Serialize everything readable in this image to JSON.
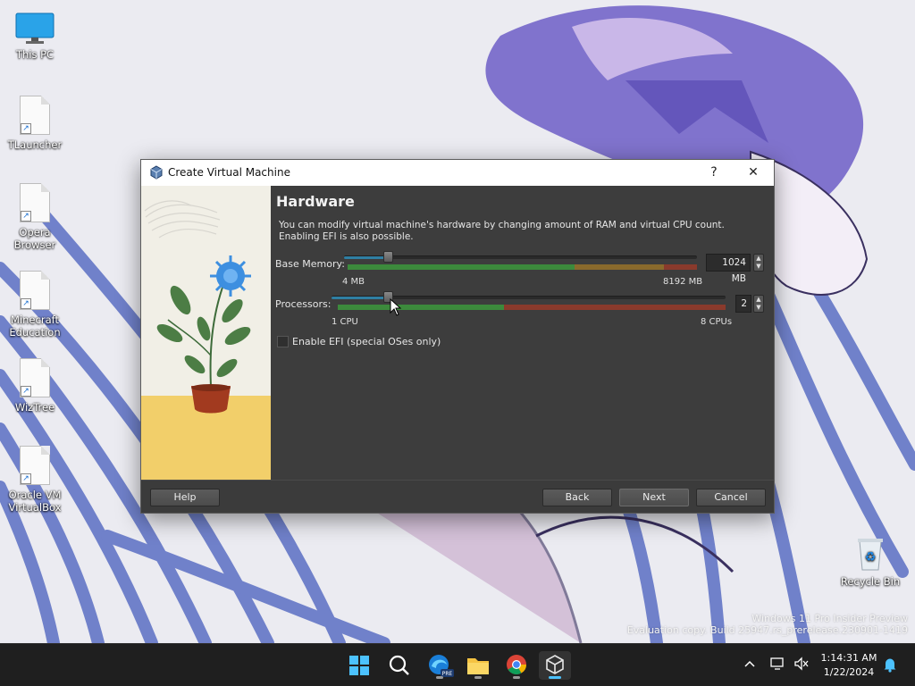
{
  "desktop": {
    "icons": [
      {
        "label": "This PC"
      },
      {
        "label": "TLauncher"
      },
      {
        "label": "Opera Browser"
      },
      {
        "label": "Minecraft Education"
      },
      {
        "label": "WizTree"
      },
      {
        "label": "Oracle VM VirtualBox"
      }
    ],
    "recycle_bin": "Recycle Bin",
    "watermark_line1": "Windows 11 Pro Insider Preview",
    "watermark_line2": "Evaluation copy. Build 25947.rs_prerelease.230901-1419"
  },
  "dialog": {
    "title": "Create Virtual Machine",
    "help_glyph": "?",
    "close_glyph": "✕",
    "heading": "Hardware",
    "description": "You can modify virtual machine's hardware by changing amount of RAM and virtual CPU count. Enabling EFI is also possible.",
    "memory": {
      "label": "Base Memory:",
      "value": "1024 MB",
      "min_label": "4 MB",
      "max_label": "8192 MB",
      "value_mb": 1024,
      "min_mb": 4,
      "max_mb": 8192
    },
    "processors": {
      "label": "Processors:",
      "value": "2",
      "min_label": "1 CPU",
      "max_label": "8 CPUs",
      "value_count": 2,
      "min_count": 1,
      "max_count": 8
    },
    "efi": {
      "label": "Enable EFI (special OSes only)",
      "checked": false
    },
    "buttons": {
      "help": "Help",
      "back": "Back",
      "next": "Next",
      "cancel": "Cancel"
    }
  },
  "taskbar": {
    "apps": [
      "start-icon",
      "search-icon",
      "edge-dev-icon",
      "file-explorer-icon",
      "chrome-icon",
      "virtualbox-icon"
    ],
    "time": "1:14:31 AM",
    "date": "1/22/2024",
    "edge_badge": "PRE"
  },
  "colors": {
    "dialog_bg": "#3d3d3d",
    "accent": "#2f7fa3",
    "green_zone": "#3c8a3c",
    "red_zone": "#8a3a2c",
    "taskbar": "#1f1f1f",
    "tray_active": "#4cc2ff"
  }
}
